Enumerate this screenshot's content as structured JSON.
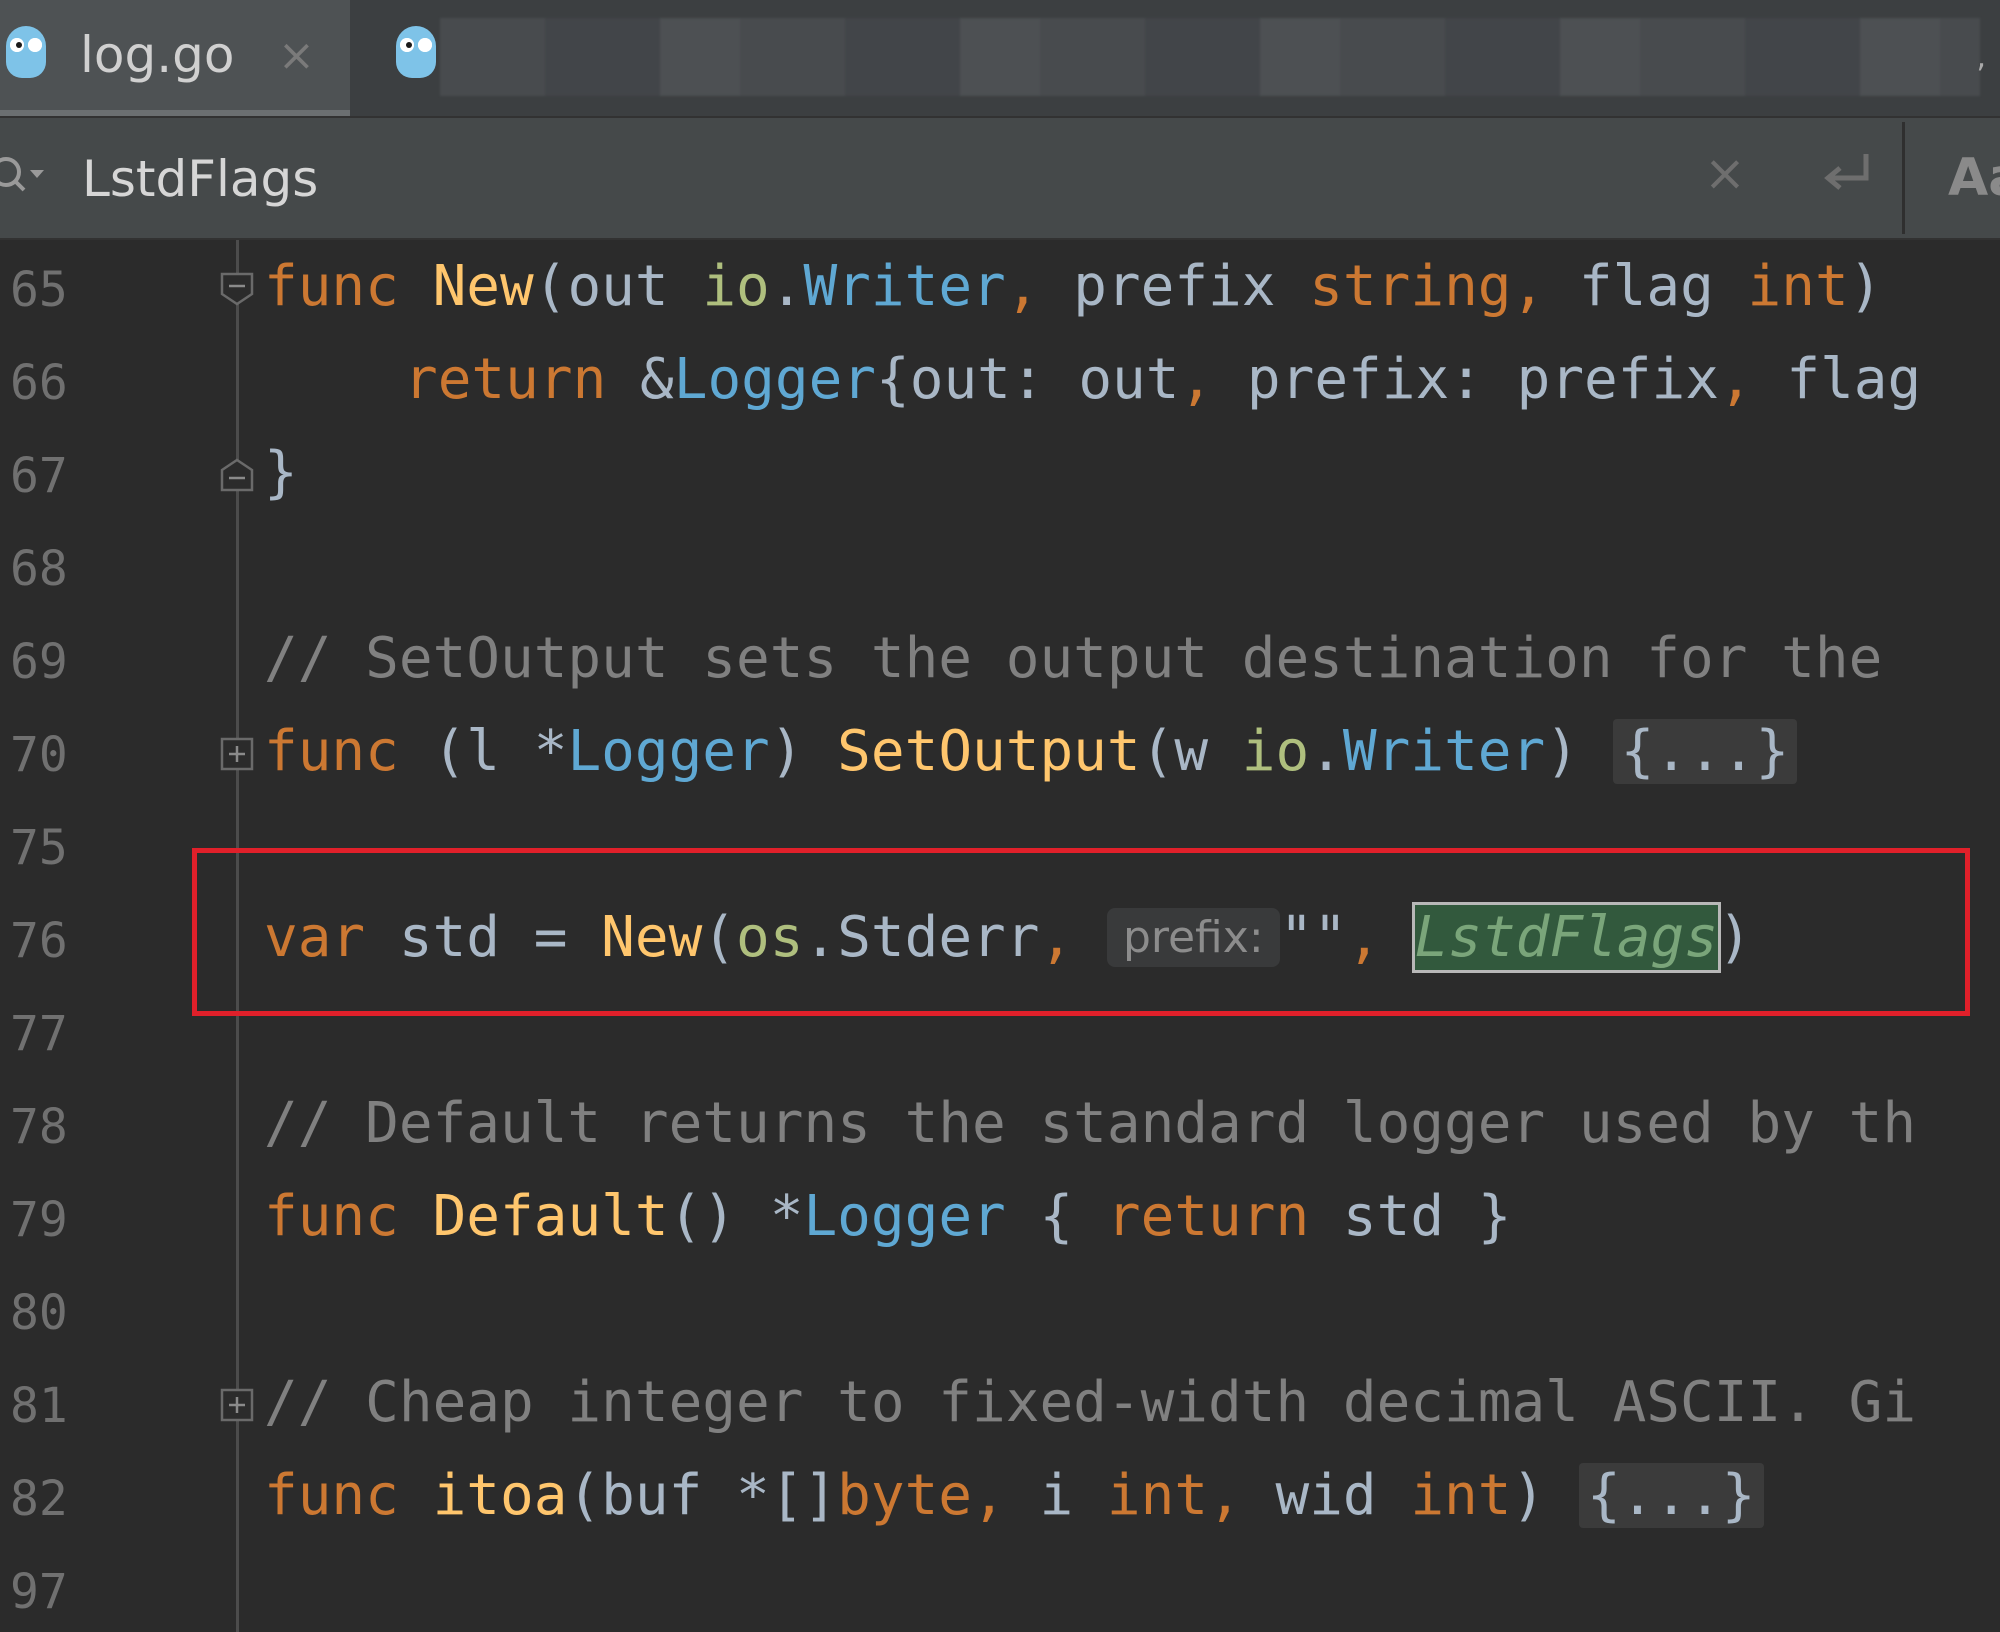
{
  "tabs": {
    "active": {
      "label": "log.go",
      "close": "×"
    },
    "overflow_glyph": ","
  },
  "find": {
    "query": "LstdFlags",
    "clear": "×",
    "match_case": "Aa"
  },
  "gutter": {
    "line_numbers": [
      "65",
      "66",
      "67",
      "68",
      "69",
      "70",
      "75",
      "76",
      "77",
      "78",
      "79",
      "80",
      "81",
      "82",
      "97"
    ]
  },
  "code": {
    "l65": {
      "kw": "func",
      "fn": "New",
      "p1": "(out ",
      "pk": "io",
      "dot": ".",
      "ty": "Writer",
      "c1": ",",
      "p2": " prefix ",
      "t2": "string",
      "c2": ",",
      "p3": " flag ",
      "t3": "int",
      "p4": ")"
    },
    "l66": {
      "kw": "return",
      "p1": " &",
      "ty": "Logger",
      "p2": "{out: out",
      "c1": ",",
      "p3": " prefix: prefix",
      "c2": ",",
      "p4": " flag"
    },
    "l67": {
      "brace": "}"
    },
    "l69": {
      "comment": "// SetOutput sets the output destination for the"
    },
    "l70": {
      "kw": "func",
      "p1": " (l *",
      "ty": "Logger",
      "p2": ") ",
      "fn": "SetOutput",
      "p3": "(w ",
      "pk": "io",
      "dot": ".",
      "ty2": "Writer",
      "p4": ") ",
      "folded": "{...}"
    },
    "l76": {
      "kw": "var",
      "p1": " std = ",
      "fn": "New",
      "p2": "(",
      "pk": "os",
      "p3": ".Stderr",
      "c1": ",",
      "hint": "prefix:",
      "str": "\"\"",
      "c2": ",",
      "match": "LstdFlags",
      "p4": ")"
    },
    "l78": {
      "comment": "// Default returns the standard logger used by th"
    },
    "l79": {
      "kw": "func",
      "fn": "Default",
      "p1": "() *",
      "ty": "Logger",
      "p2": " { ",
      "kw2": "return",
      "p3": " std }"
    },
    "l81": {
      "comment": "// Cheap integer to fixed-width decimal ASCII. Gi"
    },
    "l82": {
      "kw": "func",
      "fn": "itoa",
      "p1": "(buf *[]",
      "t1": "byte",
      "c1": ",",
      "p2": " i ",
      "t2": "int",
      "c2": ",",
      "p3": " wid ",
      "t3": "int",
      "p4": ") ",
      "folded": "{...}"
    }
  },
  "colors": {
    "background": "#2b2b2b",
    "keyword": "#cc7832",
    "function": "#ffc66d",
    "type": "#5fa8d3",
    "comment": "#808080",
    "highlight_box": "#e0202a",
    "search_match_bg": "#32593d"
  },
  "icons": [
    "gopher-icon",
    "search-icon",
    "close-icon",
    "wrap-icon",
    "fold-icon",
    "unfold-icon"
  ]
}
